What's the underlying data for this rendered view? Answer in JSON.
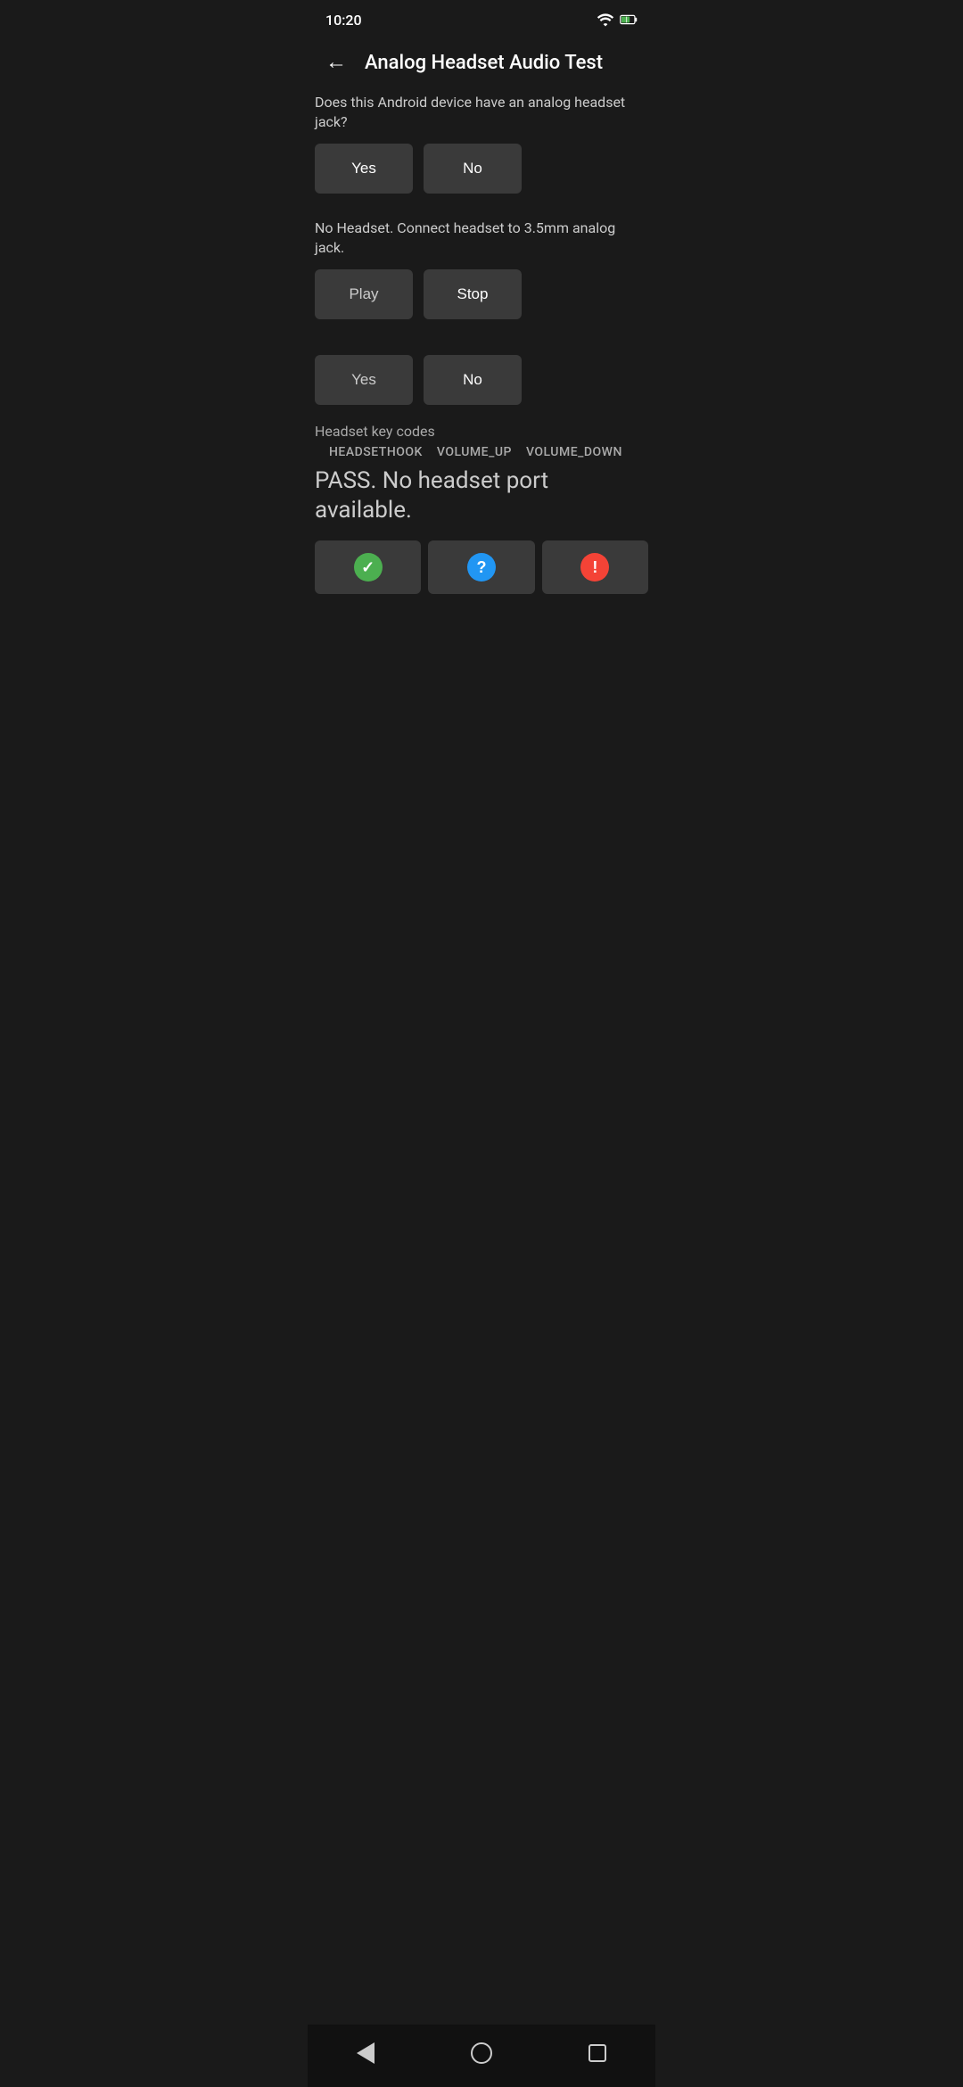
{
  "statusBar": {
    "time": "10:20"
  },
  "toolbar": {
    "back_label": "←",
    "title": "Analog Headset Audio Test"
  },
  "section1": {
    "question": "Does this Android device have an analog headset jack?",
    "yes_label": "Yes",
    "no_label": "No"
  },
  "section2": {
    "instruction": "No Headset. Connect headset to 3.5mm analog jack.",
    "play_label": "Play",
    "stop_label": "Stop",
    "yes_label": "Yes",
    "no_label": "No"
  },
  "section3": {
    "key_codes_label": "Headset key codes",
    "key_codes": [
      "HEADSETHOOK",
      "VOLUME_UP",
      "VOLUME_DOWN"
    ],
    "pass_text": "PASS. No headset port available."
  },
  "resultButtons": {
    "pass_icon": "✓",
    "question_icon": "?",
    "fail_icon": "!"
  },
  "navBar": {}
}
